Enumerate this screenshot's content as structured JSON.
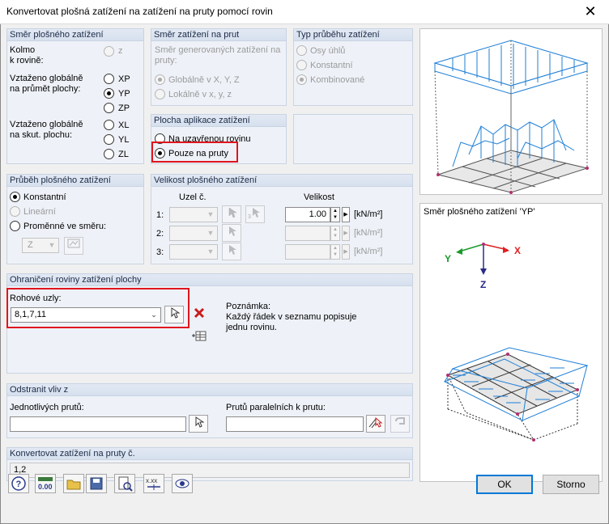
{
  "window": {
    "title": "Konvertovat plošná zatížení na zatížení na pruty pomocí rovin",
    "close_glyph": "✕"
  },
  "direction_group": {
    "title": "Směr plošného zatížení",
    "kolmo_label": "Kolmo\nk rovině:",
    "z_label": "z",
    "projected_label": "Vztaženo globálně\nna průmět plochy:",
    "xp": "XP",
    "yp": "YP",
    "zp": "ZP",
    "true_label": "Vztaženo globálně\nna skut. plochu:",
    "xl": "XL",
    "yl": "YL",
    "zl": "ZL"
  },
  "member_dir_group": {
    "title": "Směr zatížení na prut",
    "desc": "Směr generovaných zatížení na\npruty:",
    "global": "Globálně v X, Y, Z",
    "local": "Lokálně v x, y, z"
  },
  "distribution_type_group": {
    "title": "Typ průběhu zatížení",
    "axes_angle": "Osy úhlů",
    "constant": "Konstantní",
    "combined": "Kombinované"
  },
  "application_group": {
    "title": "Plocha aplikace zatížení",
    "closed_plane": "Na uzavřenou rovinu",
    "members_only": "Pouze na pruty"
  },
  "area_distribution_group": {
    "title": "Průběh plošného zatížení",
    "constant": "Konstantní",
    "linear": "Lineární",
    "variable": "Proměnné ve směru:",
    "axis_value": "Z"
  },
  "magnitude_group": {
    "title": "Velikost plošného zatížení",
    "node_header": "Uzel č.",
    "magnitude_header": "Velikost",
    "rows": [
      {
        "label": "1:",
        "value": "1.00",
        "unit": "[kN/m²]"
      },
      {
        "label": "2:",
        "value": "",
        "unit": "[kN/m²]"
      },
      {
        "label": "3:",
        "value": "",
        "unit": "[kN/m²]"
      }
    ]
  },
  "boundary_group": {
    "title": "Ohraničení roviny zatížení plochy",
    "corner_nodes_label": "Rohové uzly:",
    "corner_nodes_value": "8,1,7,11",
    "note_label": "Poznámka:",
    "note_text": "Každý řádek v seznamu popisuje\njednu rovinu."
  },
  "remove_z_group": {
    "title": "Odstranit vliv z",
    "individual_label": "Jednotlivých prutů:",
    "individual_value": "",
    "parallel_label": "Prutů paralelních k prutu:",
    "parallel_value": ""
  },
  "convert_group": {
    "title": "Konvertovat zatížení na pruty č.",
    "value": "1,2"
  },
  "preview": {
    "direction_caption": "Směr plošného zatížení 'YP'",
    "axis_x": "X",
    "axis_y": "Y",
    "axis_z": "Z"
  },
  "buttons": {
    "ok": "OK",
    "cancel": "Storno"
  },
  "colors": {
    "load_blue": "#1e7fd6",
    "highlight_red": "#e0141e",
    "axis_red": "#e02020",
    "axis_green": "#1a9a2a",
    "axis_navy": "#2a2a8a"
  }
}
